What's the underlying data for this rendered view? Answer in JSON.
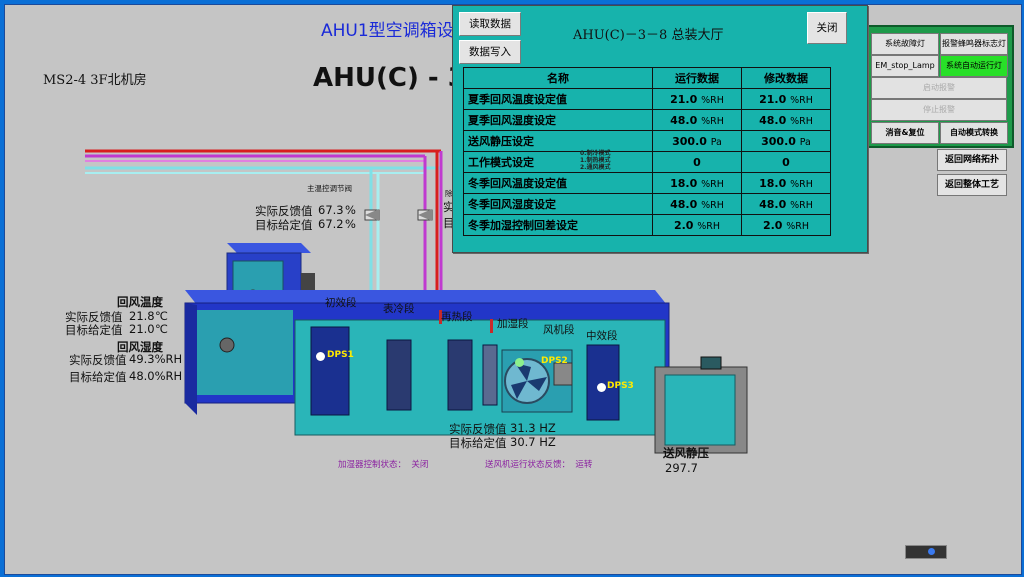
{
  "header": {
    "title": "AHU1型空调箱设",
    "location": "MS2-4 3F北机房",
    "big_title": "AHU(C) - 3"
  },
  "dialog": {
    "read_btn": "读取数据",
    "import_btn": "数据写入",
    "title": "AHU(C)－3－8 总装大厅",
    "close_btn": "关闭",
    "headers": [
      "名称",
      "运行数据",
      "修改数据"
    ],
    "mode_options": [
      "0.制冷模式",
      "1.制热模式",
      "2.通风模式"
    ],
    "rows": [
      {
        "name": "夏季回风温度设定值",
        "run": "21.0",
        "run_unit": "%RH",
        "mod": "21.0",
        "mod_unit": "%RH"
      },
      {
        "name": "夏季回风湿度设定",
        "run": "48.0",
        "run_unit": "%RH",
        "mod": "48.0",
        "mod_unit": "%RH"
      },
      {
        "name": "送风静压设定",
        "run": "300.0",
        "run_unit": "Pa",
        "mod": "300.0",
        "mod_unit": "Pa"
      },
      {
        "name": "工作模式设定",
        "run": "0",
        "run_unit": "",
        "mod": "0",
        "mod_unit": ""
      },
      {
        "name": "冬季回风温度设定值",
        "run": "18.0",
        "run_unit": "%RH",
        "mod": "18.0",
        "mod_unit": "%RH"
      },
      {
        "name": "冬季回风湿度设定",
        "run": "48.0",
        "run_unit": "%RH",
        "mod": "48.0",
        "mod_unit": "%RH"
      },
      {
        "name": "冬季加湿控制回差设定",
        "run": "2.0",
        "run_unit": "%RH",
        "mod": "2.0",
        "mod_unit": "%RH"
      }
    ]
  },
  "right_panel": {
    "fault_lamp": "系统故障灯",
    "alarm_lamp": "报警蜂鸣器标志灯",
    "em_stop": "EM_stop_Lamp",
    "auto_run": "系统自动运行灯",
    "start_alarm": "启动报警",
    "stop_alarm": "停止报警",
    "mute_reset": "消音&复位",
    "auto_mode": "自动模式转换"
  },
  "nav": {
    "topo": "返回网络拓扑",
    "process": "返回整体工艺"
  },
  "valve": {
    "label": "主温控调节阀",
    "label2": "除",
    "fb_label": "实际反馈值",
    "fb_value": "67.3",
    "sp_label": "目标给定值",
    "sp_value": "67.2",
    "unit": "%",
    "partial_label": "实",
    "partial_label2": "目"
  },
  "return_temp": {
    "title": "回风温度",
    "fb_label": "实际反馈值",
    "fb_value": "21.8",
    "sp_label": "目标给定值",
    "sp_value": "21.0",
    "unit": "℃"
  },
  "return_hum": {
    "title": "回风湿度",
    "fb_label": "实际反馈值",
    "fb_value": "49.3%RH",
    "sp_label": "目标给定值",
    "sp_value": "48.0%RH"
  },
  "sections": [
    "初效段",
    "表冷段",
    "再热段",
    "加湿段",
    "风机段",
    "中效段"
  ],
  "dps": [
    "DPS1",
    "DPS2",
    "DPS3"
  ],
  "fan": {
    "fb_label": "实际反馈值",
    "fb_value": "31.3 HZ",
    "sp_label": "目标给定值",
    "sp_value": "30.7 HZ"
  },
  "supply_pressure": {
    "title": "送风静压",
    "value": "297.7"
  },
  "status": {
    "humidifier_label": "加湿器控制状态：",
    "humidifier_value": "关闭",
    "fan_label": "送风机运行状态反馈：",
    "fan_value": "运转"
  },
  "colors": {
    "dialog_bg": "#17b3ac",
    "duct_blue": "#2236c8",
    "duct_cyan": "#2ab5b8",
    "lamp_green": "#28e028",
    "panel_green": "#1e9a4a"
  }
}
